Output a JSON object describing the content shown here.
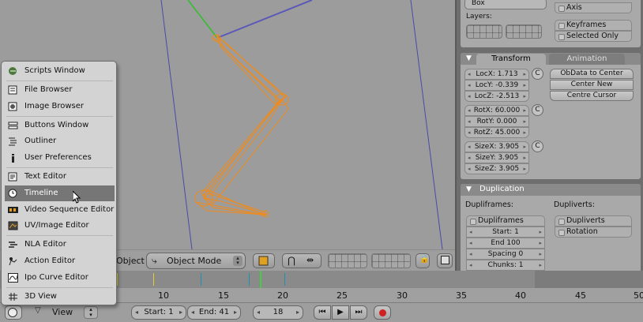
{
  "viewport": {
    "object_label": "Object",
    "mode_label": "Object Mode"
  },
  "menu": {
    "items": [
      {
        "label": "Scripts Window",
        "icon": "scripts-window-icon"
      },
      {
        "label": "File Browser",
        "icon": "file-browser-icon"
      },
      {
        "label": "Image Browser",
        "icon": "image-browser-icon"
      },
      {
        "label": "Buttons Window",
        "icon": "buttons-window-icon"
      },
      {
        "label": "Outliner",
        "icon": "outliner-icon"
      },
      {
        "label": "User Preferences",
        "icon": "user-preferences-icon"
      },
      {
        "label": "Text Editor",
        "icon": "text-editor-icon"
      },
      {
        "label": "Timeline",
        "icon": "timeline-icon",
        "highlighted": true
      },
      {
        "label": "Video Sequence Editor",
        "icon": "video-sequence-icon"
      },
      {
        "label": "UV/Image Editor",
        "icon": "uv-image-editor-icon"
      },
      {
        "label": "NLA Editor",
        "icon": "nla-editor-icon"
      },
      {
        "label": "Action Editor",
        "icon": "action-editor-icon"
      },
      {
        "label": "Ipo Curve Editor",
        "icon": "ipo-curve-editor-icon"
      },
      {
        "label": "3D View",
        "icon": "3d-view-icon"
      }
    ]
  },
  "buttons": {
    "draw_type_value": "Box",
    "axis_label": "Axis",
    "layers_label": "Layers:",
    "keyframes_label": "Keyframes",
    "selected_only_label": "Selected Only",
    "tabs": {
      "transform": "Transform",
      "animation": "Animation"
    },
    "loc": {
      "x": "LocX: 1.713",
      "y": "LocY: -0.339",
      "z": "LocZ: -2.513"
    },
    "rot": {
      "x": "RotX: 60.000",
      "y": "RotY: 0.000",
      "z": "RotZ: 45.000"
    },
    "size": {
      "x": "SizeX: 3.905",
      "y": "SizeY: 3.905",
      "z": "SizeZ: 3.905"
    },
    "c_label": "C",
    "obdata_to_center": "ObData to Center",
    "center_new": "Center New",
    "centre_cursor": "Centre Cursor",
    "duplication": {
      "title": "Duplication",
      "dupliframes_heading": "Dupliframes:",
      "dupliverts_heading": "Dupliverts:",
      "dupliframes_toggle": "Dupliframes",
      "start": "Start: 1",
      "end": "End 100",
      "spacing": "Spacing 0",
      "chunks": "Chunks: 1",
      "dupliverts_toggle": "Dupliverts",
      "rotation_toggle": "Rotation"
    }
  },
  "timeline": {
    "ticks": [
      "10",
      "15",
      "20",
      "25",
      "30",
      "35",
      "40",
      "45",
      "50"
    ],
    "view_menu": "View",
    "start": "Start: 1",
    "end": "End: 41",
    "current_frame": "18"
  }
}
